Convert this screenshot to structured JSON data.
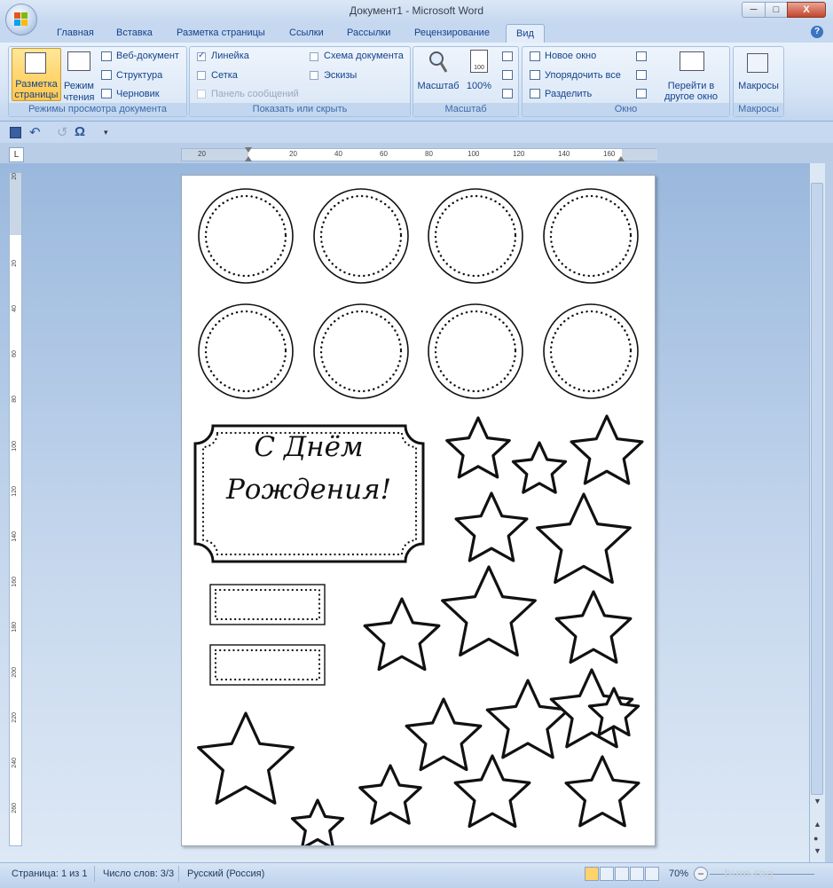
{
  "window": {
    "title": "Документ1 - Microsoft Word",
    "min": "─",
    "max": "□",
    "close": "X"
  },
  "tabs": [
    "Главная",
    "Вставка",
    "Разметка страницы",
    "Ссылки",
    "Рассылки",
    "Рецензирование",
    "Вид"
  ],
  "active_tab": "Вид",
  "help": "?",
  "ribbon": {
    "views": {
      "label": "Режимы просмотра документа",
      "print_layout": [
        "Разметка",
        "страницы"
      ],
      "reading": [
        "Режим",
        "чтения"
      ],
      "web": "Веб-документ",
      "outline": "Структура",
      "draft": "Черновик"
    },
    "show": {
      "label": "Показать или скрыть",
      "ruler": "Линейка",
      "gridlines": "Сетка",
      "message_bar": "Панель сообщений",
      "doc_map": "Схема документа",
      "thumbnails": "Эскизы",
      "ruler_checked": true,
      "gridlines_checked": false,
      "doc_map_checked": false,
      "thumbnails_checked": false
    },
    "zoom": {
      "label": "Масштаб",
      "zoom": "Масштаб",
      "hundred": "100%",
      "hundred_icon": "100"
    },
    "window": {
      "label": "Окно",
      "new": "Новое окно",
      "arrange": "Упорядочить все",
      "split": "Разделить",
      "switch": [
        "Перейти в",
        "другое окно"
      ]
    },
    "macros": {
      "label": "Макросы",
      "macros": "Макросы"
    }
  },
  "qat": {
    "omega": "Ω",
    "undo": "↶",
    "redo": "↺"
  },
  "ruler": {
    "corner": "L",
    "h_ticks": [
      "20",
      "20",
      "40",
      "60",
      "80",
      "100",
      "120",
      "140",
      "160"
    ],
    "v_ticks": [
      "20",
      "20",
      "40",
      "60",
      "80",
      "100",
      "120",
      "140",
      "160",
      "180",
      "200",
      "220",
      "240",
      "260"
    ]
  },
  "document": {
    "greeting_line1": "С Днём",
    "greeting_line2": "Рождения!"
  },
  "status": {
    "page": "Страница: 1 из 1",
    "words": "Число слов: 3/3",
    "lang": "Русский (Россия)",
    "zoom": "70%",
    "minus": "−"
  },
  "watermark": "bum-rag",
  "colors": {
    "ribbon_text": "#15428b",
    "active_tab_bg": "#e3edf9"
  }
}
